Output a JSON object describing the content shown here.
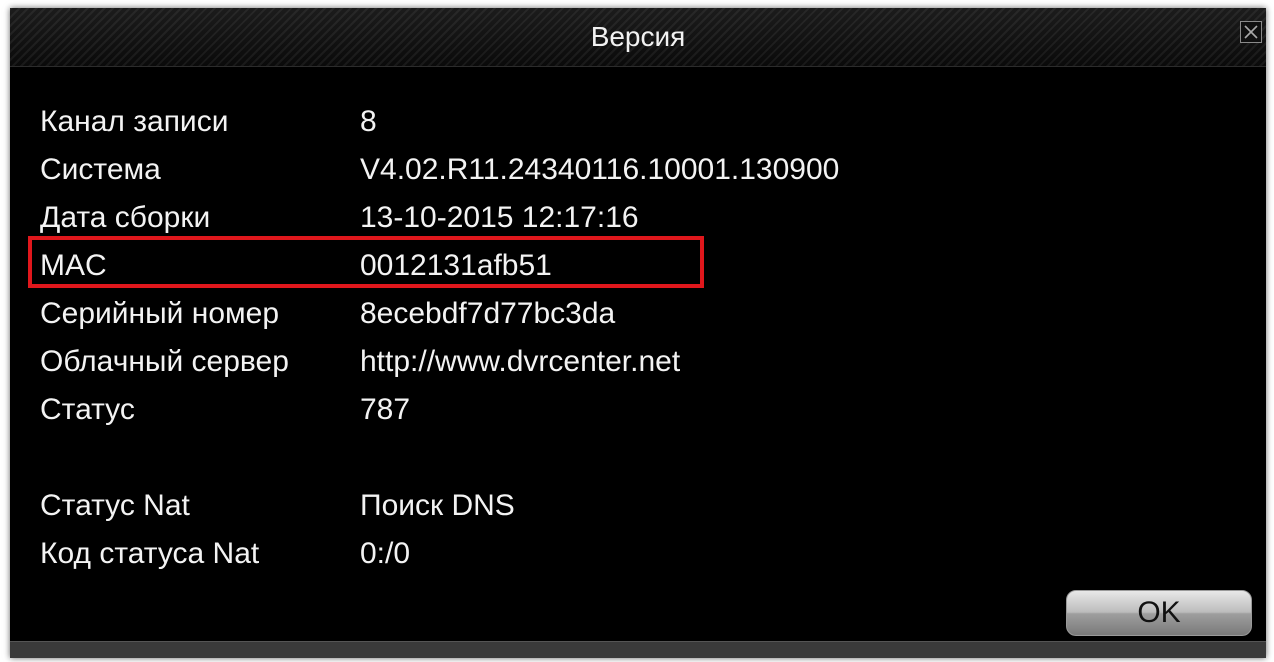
{
  "window": {
    "title": "Версия",
    "close_icon": "close-icon"
  },
  "info": {
    "rows": [
      {
        "label": "Канал записи",
        "value": "8"
      },
      {
        "label": "Система",
        "value": "V4.02.R11.24340116.10001.130900"
      },
      {
        "label": "Дата сборки",
        "value": "13-10-2015 12:17:16"
      },
      {
        "label": "MAC",
        "value": "0012131afb51"
      },
      {
        "label": "Серийный номер",
        "value": "8ecebdf7d77bc3da"
      },
      {
        "label": "Облачный сервер",
        "value": "http://www.dvrcenter.net"
      },
      {
        "label": "Статус",
        "value": "787"
      }
    ],
    "nat_rows": [
      {
        "label": "Статус Nat",
        "value": "Поиск DNS"
      },
      {
        "label": "Код статуса Nat",
        "value": "0:/0"
      }
    ]
  },
  "buttons": {
    "ok_label": "OK"
  },
  "colors": {
    "highlight": "#e0171c",
    "background": "#000000",
    "text": "#f3f3f3"
  }
}
